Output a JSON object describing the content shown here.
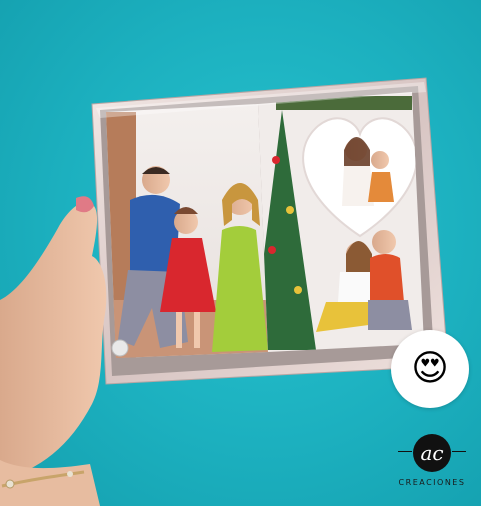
{
  "scene": {
    "background_color": "#1fb4c2",
    "objects": [
      "hand",
      "bracelet",
      "mirror-photo-frame",
      "family-photo-collage",
      "christmas-tree",
      "heart-photo"
    ]
  },
  "reaction": {
    "emoji": "😍",
    "icon": "heart-eyes-emoji-icon"
  },
  "brand": {
    "monogram": "ac",
    "name": "CREACIONES"
  }
}
